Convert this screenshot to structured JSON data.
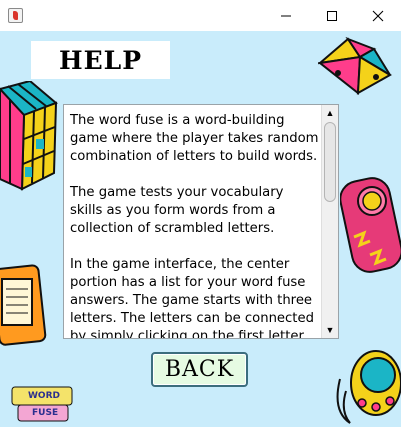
{
  "window": {
    "title": "",
    "icon": "java-icon",
    "buttons": [
      "minimize-icon",
      "maximize-icon",
      "close-icon"
    ]
  },
  "help": {
    "title": "HELP",
    "body": "The word fuse is a word-building game where the player takes random combination of letters to build words.\n\nThe game tests your vocabulary skills as you form words from a collection of scrambled letters.\n\nIn the game interface, the center portion has a list for your word fuse answers. The game starts with three letters. The letters can be connected by simply clicking on the first letter of"
  },
  "actions": {
    "back_label": "BACK"
  },
  "logo": {
    "line1": "WORD",
    "line2": "FUSE"
  },
  "colors": {
    "background": "#c9ecfb",
    "title_box": "#ffffff",
    "back_button": "#e6fbe3",
    "back_border": "#3c6e7e"
  }
}
